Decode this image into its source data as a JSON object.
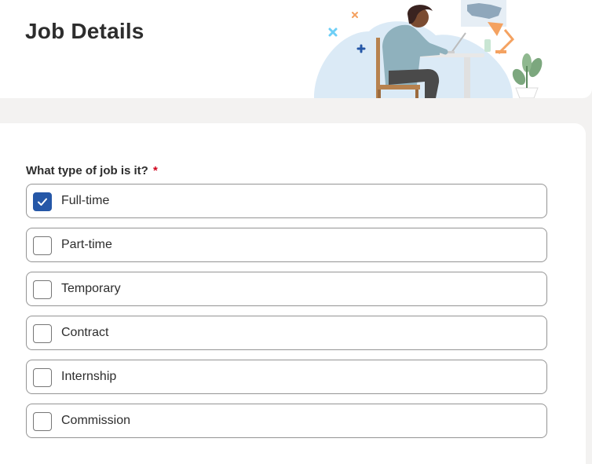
{
  "header": {
    "title": "Job Details"
  },
  "question": {
    "label": "What type of job is it?",
    "required_marker": "*"
  },
  "options": [
    {
      "label": "Full-time",
      "checked": true
    },
    {
      "label": "Part-time",
      "checked": false
    },
    {
      "label": "Temporary",
      "checked": false
    },
    {
      "label": "Contract",
      "checked": false
    },
    {
      "label": "Internship",
      "checked": false
    },
    {
      "label": "Commission",
      "checked": false
    }
  ],
  "icons": {
    "checkbox_checked": "check-icon",
    "illustration": "person-at-desk-illustration"
  },
  "colors": {
    "accent": "#2557a7",
    "required": "#d0021b",
    "text": "#2d2d2d",
    "page_background": "#f3f2f1",
    "border": "#949494"
  }
}
